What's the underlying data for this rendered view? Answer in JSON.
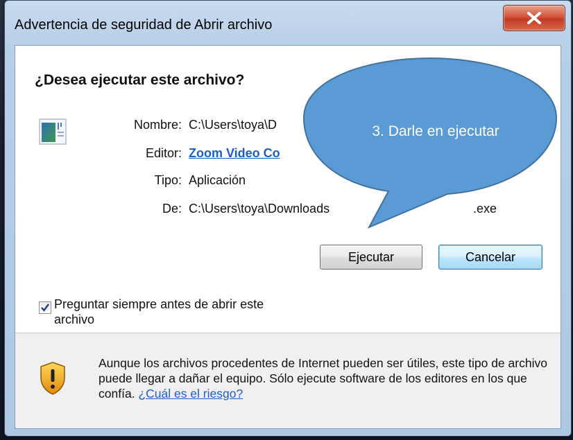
{
  "window": {
    "title": "Advertencia de seguridad de Abrir archivo",
    "close_label": "X"
  },
  "dialog": {
    "question": "¿Desea ejecutar este archivo?",
    "fields": [
      {
        "label": "Nombre:",
        "value": "C:\\Users\\toya\\D"
      },
      {
        "label": "Editor:",
        "value": "Zoom Video Co"
      },
      {
        "label": "Tipo:",
        "value": "Aplicación"
      },
      {
        "label": "De:",
        "value": "C:\\Users\\toya\\Downloads",
        "value_tail": ".exe"
      }
    ],
    "run_button": "Ejecutar",
    "cancel_button": "Cancelar",
    "always_ask": {
      "label": "Preguntar siempre antes de abrir este archivo",
      "checked": true
    }
  },
  "warning": {
    "text": "Aunque los archivos procedentes de Internet pueden ser útiles, este tipo de archivo puede llegar a dañar el equipo. Sólo ejecute software de los editores en los que confía.",
    "link": "¿Cuál es el riesgo?"
  },
  "callout": {
    "text": "3. Darle en ejecutar",
    "fill_color": "#5b9bd5",
    "stroke_color": "#41719c"
  },
  "icons": {
    "file": "application-window-icon",
    "shield": "security-shield-warning-icon",
    "close": "close-x-icon",
    "checkbox": "checkmark-icon"
  }
}
